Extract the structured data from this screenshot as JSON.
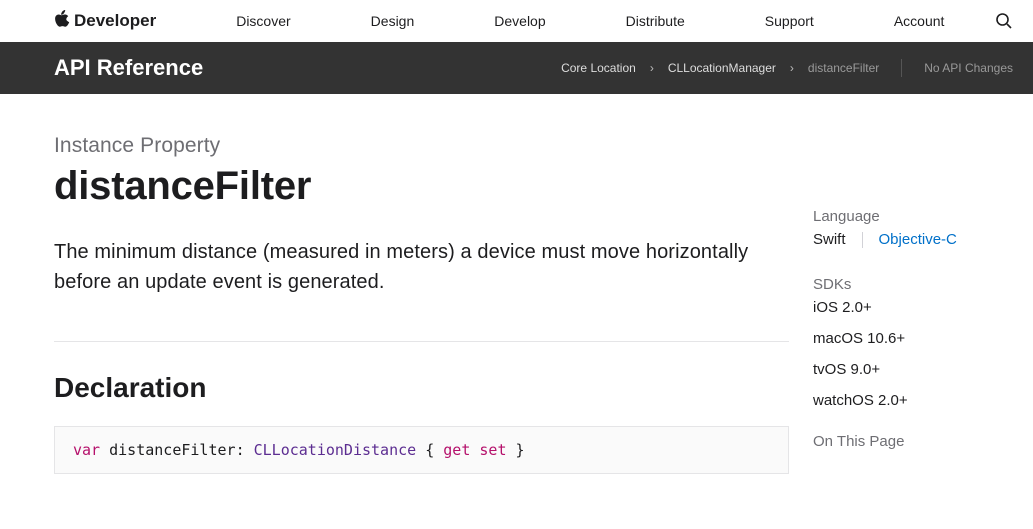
{
  "nav": {
    "brand": "Developer",
    "links": [
      "Discover",
      "Design",
      "Develop",
      "Distribute",
      "Support",
      "Account"
    ]
  },
  "subheader": {
    "title": "API Reference",
    "breadcrumbs": [
      {
        "label": "Core Location",
        "current": false
      },
      {
        "label": "CLLocationManager",
        "current": false
      },
      {
        "label": "distanceFilter",
        "current": true
      }
    ],
    "api_changes": "No API Changes"
  },
  "doc": {
    "eyebrow": "Instance Property",
    "title": "distanceFilter",
    "summary": "The minimum distance (measured in meters) a device must move horizontally before an update event is generated.",
    "declaration_heading": "Declaration",
    "declaration": {
      "kw_var": "var",
      "identifier": "distanceFilter",
      "colon_space": ": ",
      "type": "CLLocationDistance",
      "open": " { ",
      "get": "get",
      "set": "set",
      "close": " }"
    }
  },
  "sidebar": {
    "language_label": "Language",
    "lang_active": "Swift",
    "lang_other": "Objective-C",
    "sdks_label": "SDKs",
    "sdks": [
      "iOS 2.0+",
      "macOS 10.6+",
      "tvOS 9.0+",
      "watchOS 2.0+"
    ],
    "on_this_page_label": "On This Page"
  }
}
